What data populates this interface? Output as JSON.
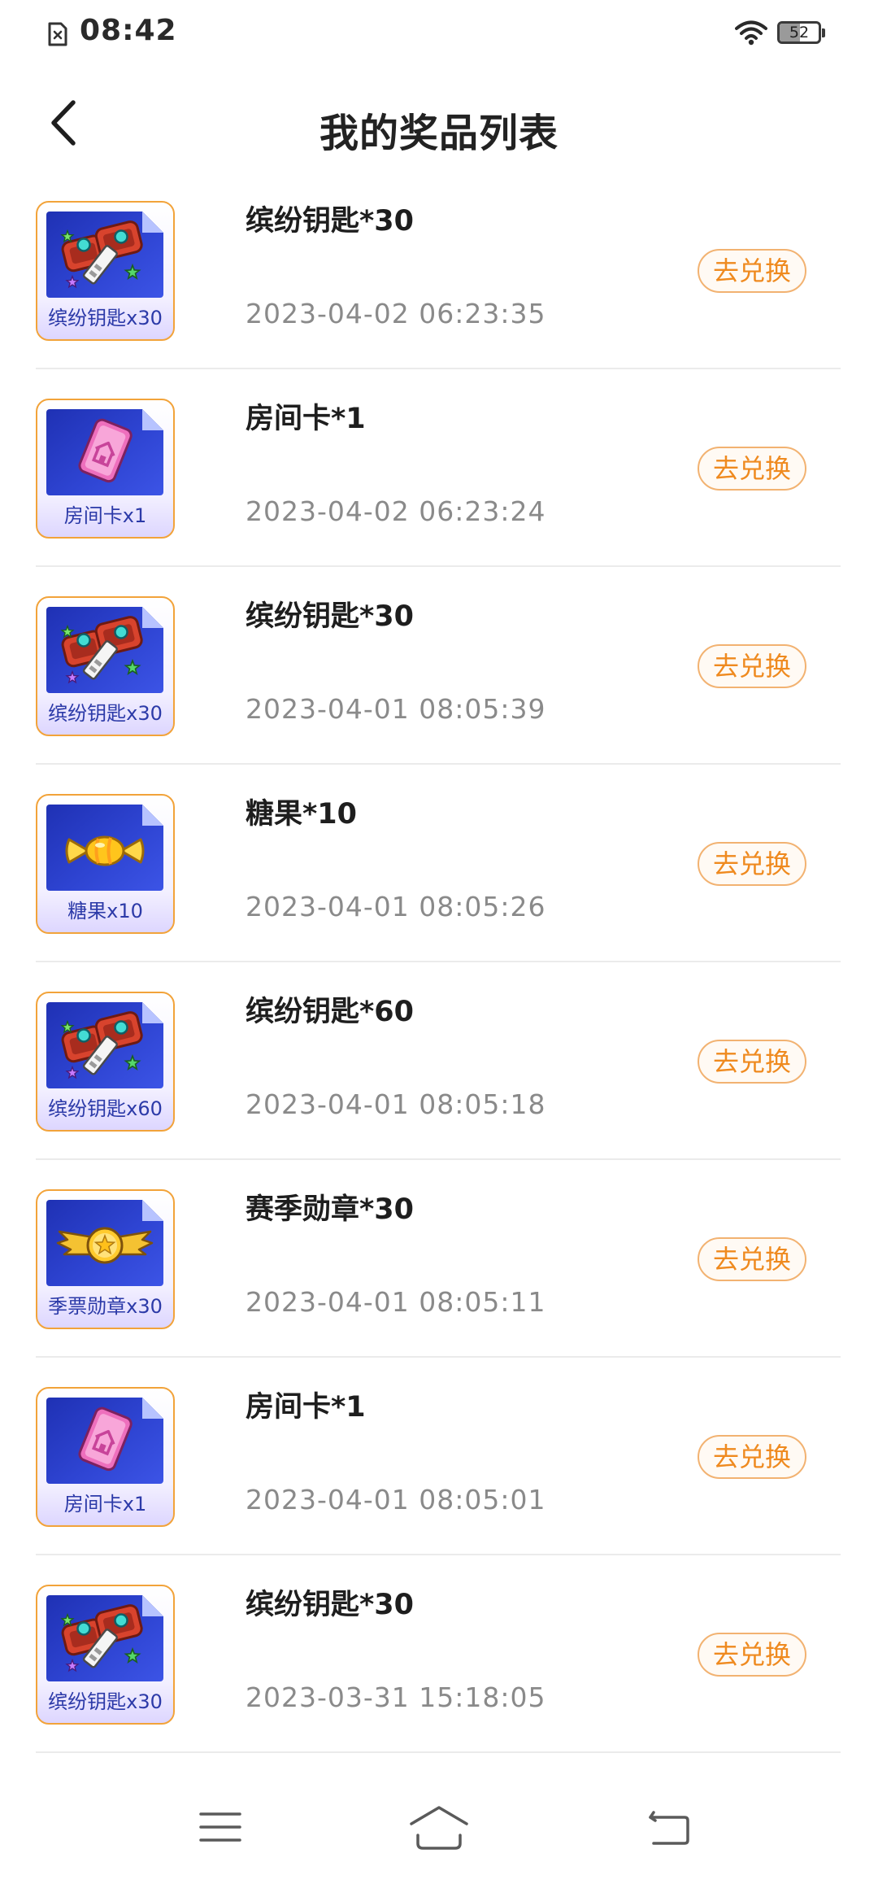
{
  "status_bar": {
    "time": "08:42",
    "battery": "52",
    "icons": [
      "no-sim-icon",
      "wifi-icon",
      "battery-icon"
    ]
  },
  "header": {
    "title": "我的奖品列表",
    "back_icon": "back-arrow-icon"
  },
  "redeem_label": "去兑换",
  "colors": {
    "accent": "#ef8a1f",
    "icon_border": "#f2a33a",
    "icon_panel": "#2e44d2"
  },
  "prizes": [
    {
      "name": "缤纷钥匙*30",
      "time": "2023-04-02 06:23:35",
      "icon_label": "缤纷钥匙x30",
      "icon": "colorful-key-icon"
    },
    {
      "name": "房间卡*1",
      "time": "2023-04-02 06:23:24",
      "icon_label": "房间卡x1",
      "icon": "room-card-icon"
    },
    {
      "name": "缤纷钥匙*30",
      "time": "2023-04-01 08:05:39",
      "icon_label": "缤纷钥匙x30",
      "icon": "colorful-key-icon"
    },
    {
      "name": "糖果*10",
      "time": "2023-04-01 08:05:26",
      "icon_label": "糖果x10",
      "icon": "candy-icon"
    },
    {
      "name": "缤纷钥匙*60",
      "time": "2023-04-01 08:05:18",
      "icon_label": "缤纷钥匙x60",
      "icon": "colorful-key-icon"
    },
    {
      "name": "赛季勋章*30",
      "time": "2023-04-01 08:05:11",
      "icon_label": "季票勋章x30",
      "icon": "season-medal-icon"
    },
    {
      "name": "房间卡*1",
      "time": "2023-04-01 08:05:01",
      "icon_label": "房间卡x1",
      "icon": "room-card-icon"
    },
    {
      "name": "缤纷钥匙*30",
      "time": "2023-03-31 15:18:05",
      "icon_label": "缤纷钥匙x30",
      "icon": "colorful-key-icon"
    }
  ],
  "nav": {
    "icons": [
      "menu-icon",
      "home-icon",
      "back-icon"
    ]
  }
}
